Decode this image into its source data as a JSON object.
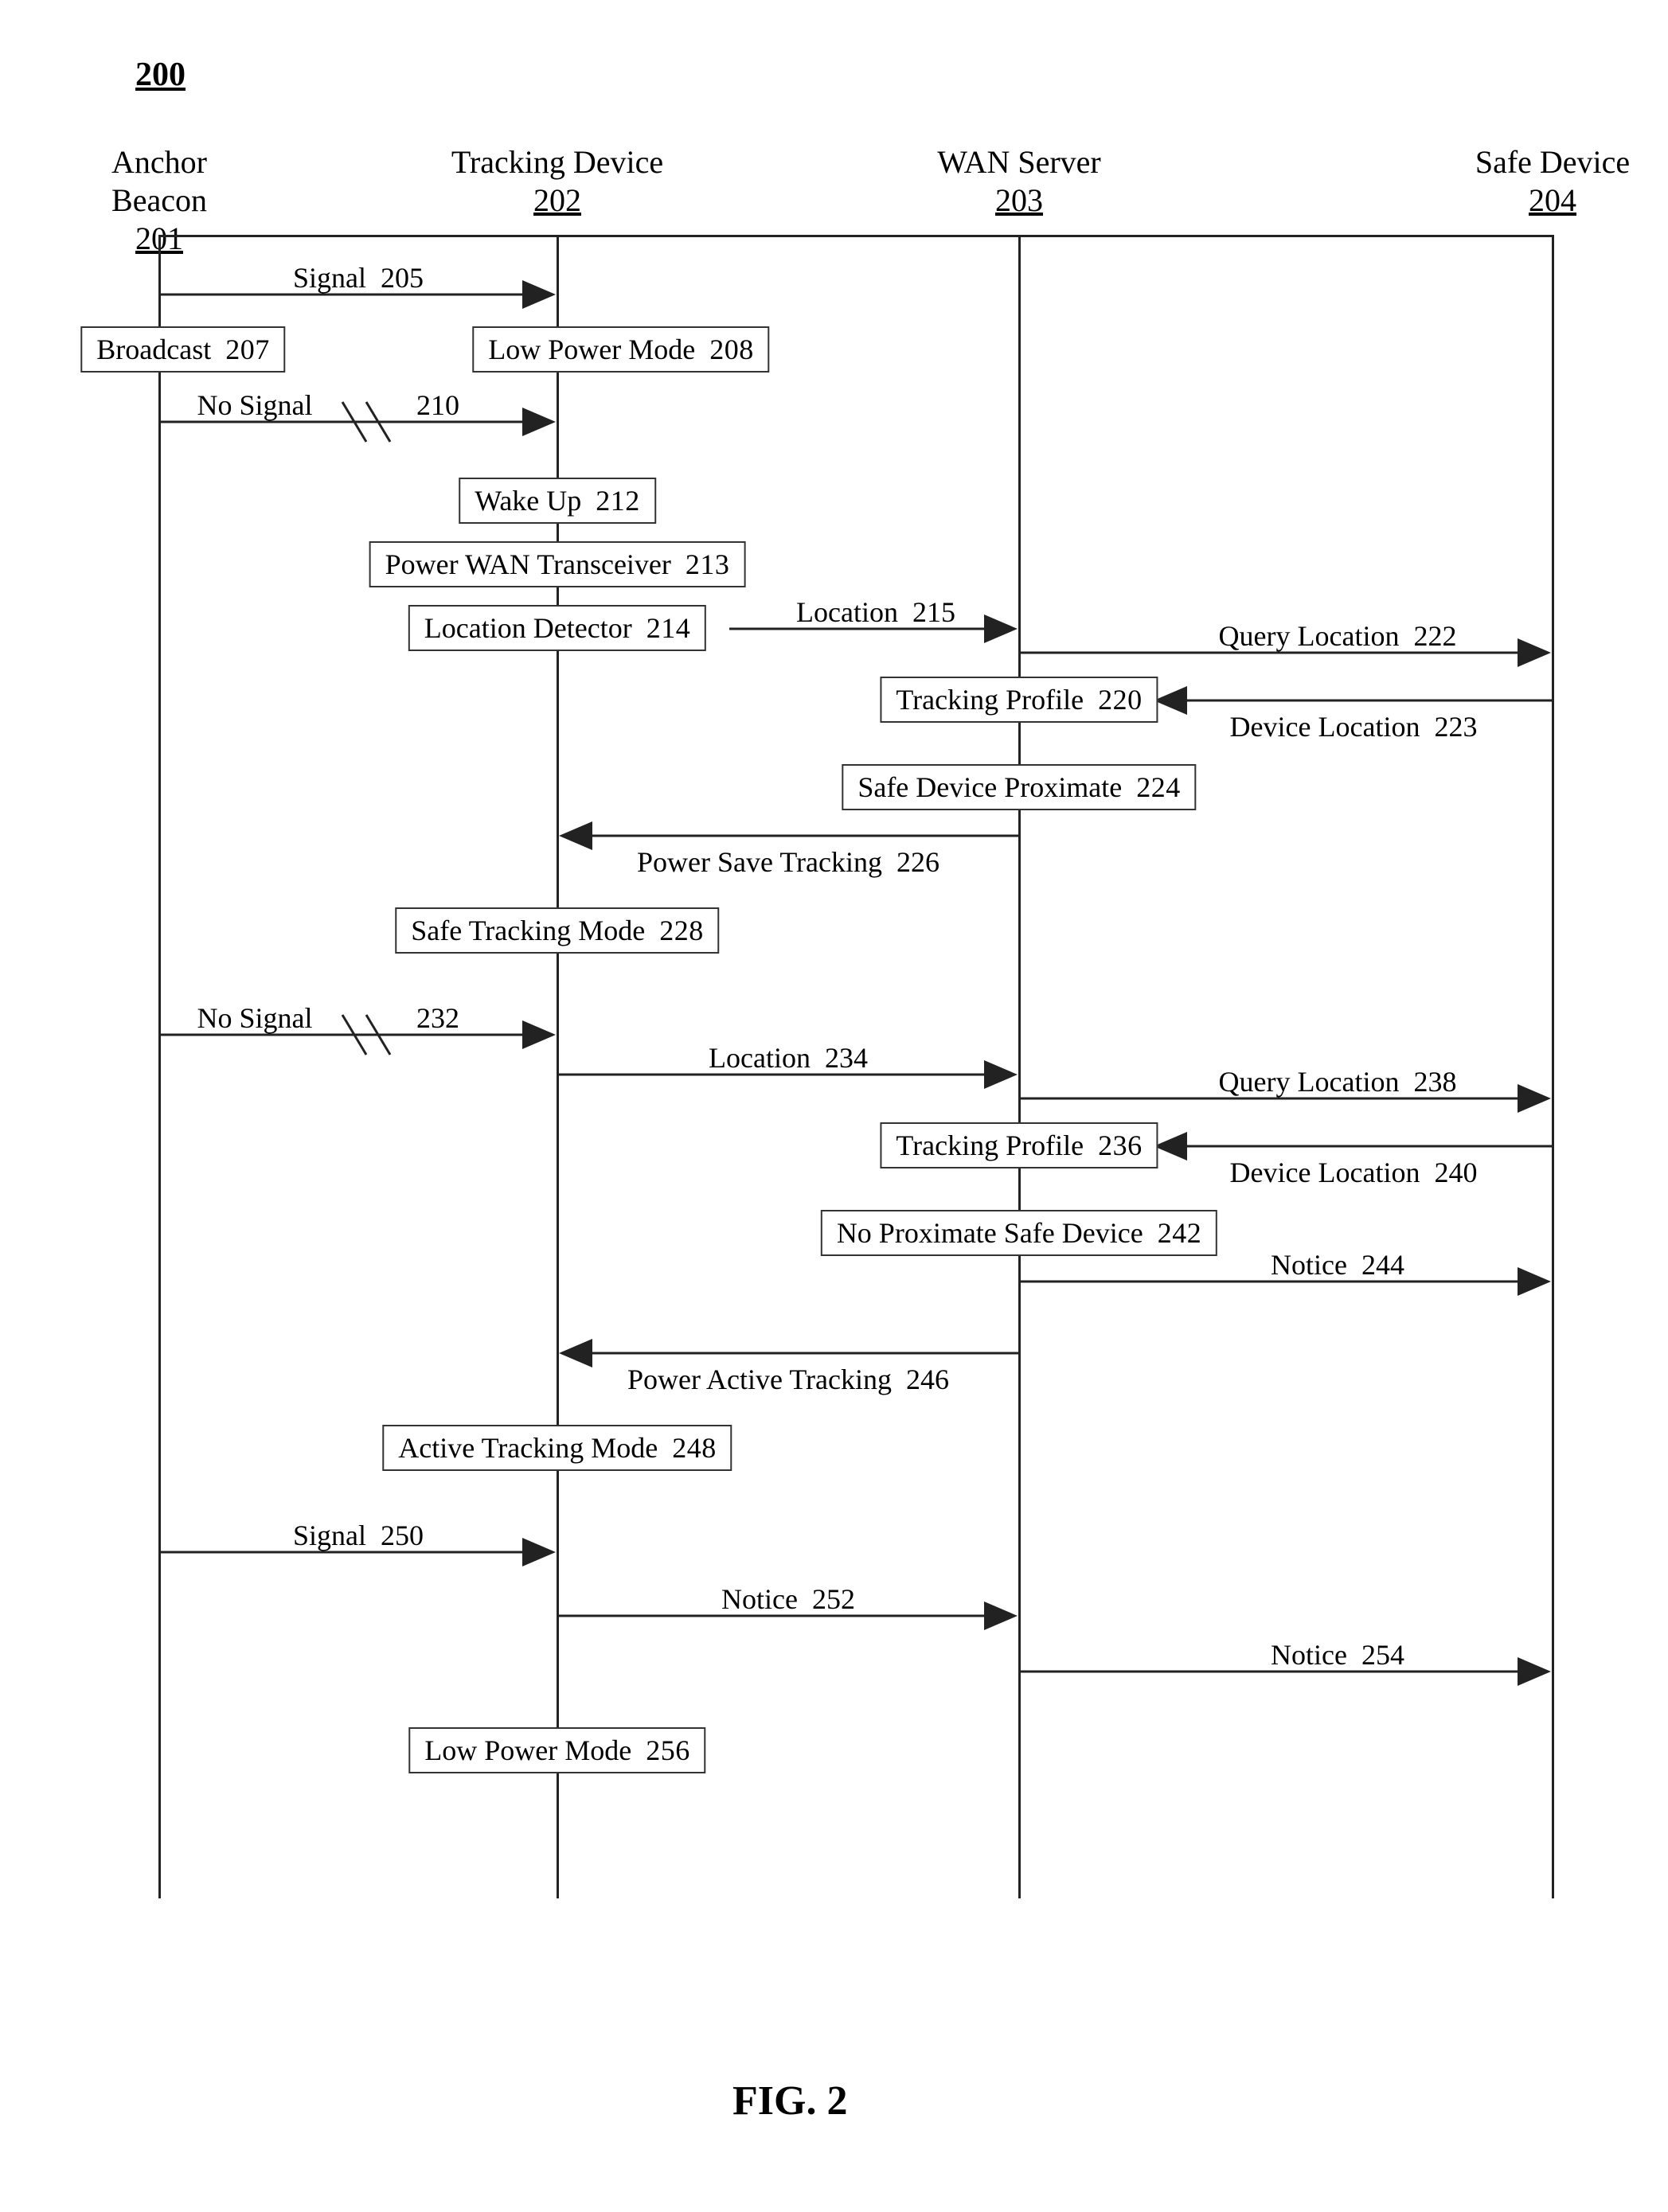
{
  "figure_number": "200",
  "figure_label": "FIG. 2",
  "lanes": [
    {
      "name": "Anchor Beacon",
      "id": "201"
    },
    {
      "name": "Tracking Device",
      "id": "202"
    },
    {
      "name": "WAN Server",
      "id": "203"
    },
    {
      "name": "Safe Device",
      "id": "204"
    }
  ],
  "messages": {
    "m205": {
      "text": "Signal",
      "num": "205"
    },
    "m210": {
      "text": "No Signal",
      "num": "210"
    },
    "m215": {
      "text": "Location",
      "num": "215"
    },
    "m222": {
      "text": "Query Location",
      "num": "222"
    },
    "m223": {
      "text": "Device Location",
      "num": "223"
    },
    "m226": {
      "text": "Power Save Tracking",
      "num": "226"
    },
    "m232": {
      "text": "No Signal",
      "num": "232"
    },
    "m234": {
      "text": "Location",
      "num": "234"
    },
    "m238": {
      "text": "Query Location",
      "num": "238"
    },
    "m240": {
      "text": "Device Location",
      "num": "240"
    },
    "m244": {
      "text": "Notice",
      "num": "244"
    },
    "m246": {
      "text": "Power Active Tracking",
      "num": "246"
    },
    "m250": {
      "text": "Signal",
      "num": "250"
    },
    "m252": {
      "text": "Notice",
      "num": "252"
    },
    "m254": {
      "text": "Notice",
      "num": "254"
    }
  },
  "boxes": {
    "b207": {
      "text": "Broadcast",
      "num": "207"
    },
    "b208": {
      "text": "Low Power Mode",
      "num": "208"
    },
    "b212": {
      "text": "Wake Up",
      "num": "212"
    },
    "b213": {
      "text": "Power WAN Transceiver",
      "num": "213"
    },
    "b214": {
      "text": "Location Detector",
      "num": "214"
    },
    "b220": {
      "text": "Tracking Profile",
      "num": "220"
    },
    "b224": {
      "text": "Safe Device Proximate",
      "num": "224"
    },
    "b228": {
      "text": "Safe Tracking Mode",
      "num": "228"
    },
    "b236": {
      "text": "Tracking Profile",
      "num": "236"
    },
    "b242": {
      "text": "No Proximate Safe Device",
      "num": "242"
    },
    "b248": {
      "text": "Active Tracking Mode",
      "num": "248"
    },
    "b256": {
      "text": "Low Power Mode",
      "num": "256"
    }
  }
}
